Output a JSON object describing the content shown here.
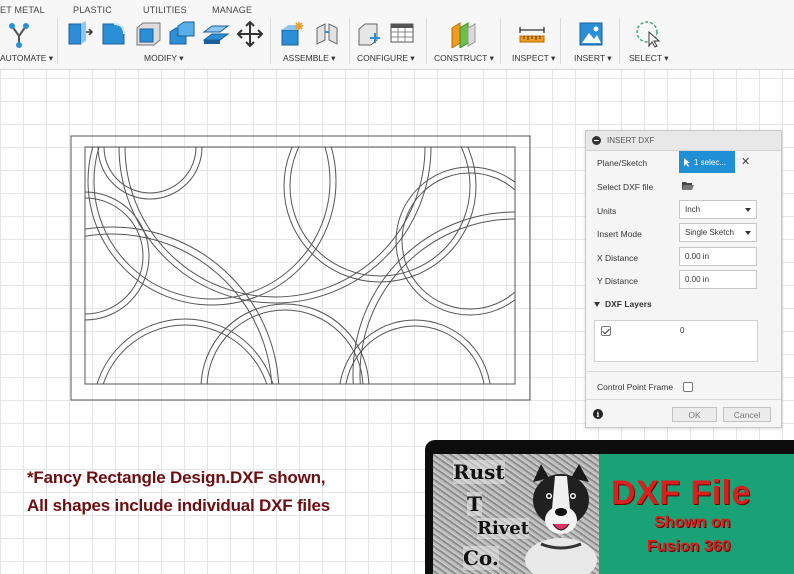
{
  "toolbar": {
    "tabs": [
      "ET METAL",
      "PLASTIC",
      "UTILITIES",
      "MANAGE"
    ],
    "groups": {
      "automate": "AUTOMATE ▾",
      "modify": "MODIFY ▾",
      "assemble": "ASSEMBLE ▾",
      "configure": "CONFIGURE ▾",
      "construct": "CONSTRUCT ▾",
      "inspect": "INSPECT ▾",
      "insert": "INSERT ▾",
      "select": "SELECT ▾"
    }
  },
  "panel": {
    "title": "INSERT DXF",
    "plane_label": "Plane/Sketch",
    "plane_value": "1 selec...",
    "file_label": "Select DXF file",
    "units_label": "Units",
    "units_value": "Inch",
    "mode_label": "Insert Mode",
    "mode_value": "Single Sketch",
    "x_label": "X Distance",
    "x_value": "0.00 in",
    "y_label": "Y Distance",
    "y_value": "0.00 in",
    "layers_label": "DXF Layers",
    "layer_name": "0",
    "layer_checked": true,
    "cpf_label": "Control Point Frame",
    "cpf_checked": false,
    "ok_label": "OK",
    "cancel_label": "Cancel"
  },
  "caption": {
    "line1": "*Fancy Rectangle Design.DXF shown,",
    "line2": "All shapes include individual DXF files"
  },
  "banner": {
    "logo_letters": [
      "Rust",
      "T",
      "Rivet",
      "Co."
    ],
    "title": "DXF File",
    "line1": "Shown on",
    "line2": "Fusion 360"
  },
  "colors": {
    "accent": "#1f8fd6",
    "caption": "#6b0f12",
    "banner_green": "#1aa277",
    "banner_red": "#d8201f"
  }
}
